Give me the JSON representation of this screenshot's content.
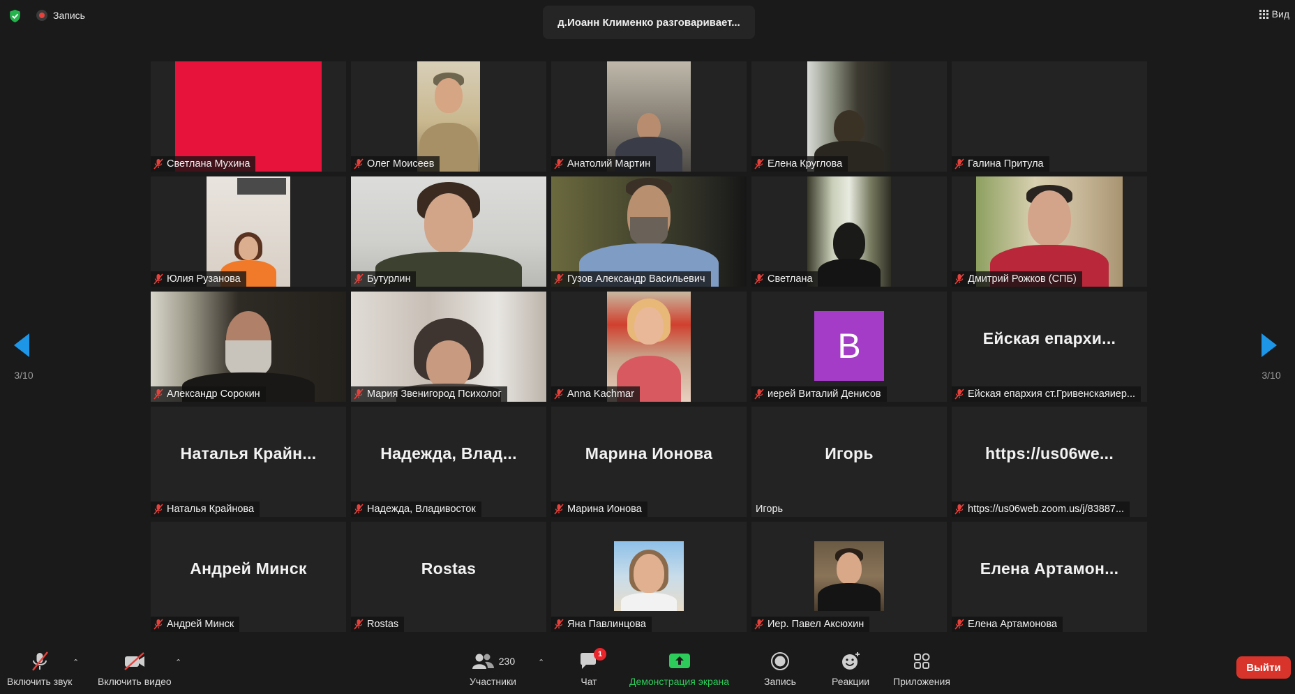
{
  "topbar": {
    "recording": "Запись",
    "speaker": "д.Иоанн Клименко разговаривает...",
    "view": "Вид"
  },
  "pagination": {
    "left": "3/10",
    "right": "3/10"
  },
  "tiles": [
    {
      "label": "Светлана Мухина",
      "big": ""
    },
    {
      "label": "Олег Моисеев",
      "big": ""
    },
    {
      "label": "Анатолий Мартин",
      "big": ""
    },
    {
      "label": "Елена Круглова",
      "big": ""
    },
    {
      "label": "Галина Притула",
      "big": ""
    },
    {
      "label": "Юлия Рузанова",
      "big": ""
    },
    {
      "label": "Бутурлин",
      "big": ""
    },
    {
      "label": "Гузов Александр Васильевич",
      "big": ""
    },
    {
      "label": "Светлана",
      "big": ""
    },
    {
      "label": "Дмитрий Рожков (СПБ)",
      "big": ""
    },
    {
      "label": "Александр Сорокин",
      "big": ""
    },
    {
      "label": "Мария  Звенигород Психолог",
      "big": ""
    },
    {
      "label": "Anna Kachmar",
      "big": ""
    },
    {
      "label": "иерей Виталий Денисов",
      "big": "",
      "avatar": "В"
    },
    {
      "label": "Ейская епархия ст.Гривенскаяиер...",
      "big": "Ейская  епархи..."
    },
    {
      "label": "Наталья Крайнова",
      "big": "Наталья  Крайн..."
    },
    {
      "label": "Надежда, Владивосток",
      "big": "Надежда,  Влад..."
    },
    {
      "label": "Марина Ионова",
      "big": "Марина Ионова"
    },
    {
      "label": "Игорь",
      "big": "Игорь"
    },
    {
      "label": "https://us06web.zoom.us/j/83887...",
      "big": "https://us06we..."
    },
    {
      "label": "Андрей Минск",
      "big": "Андрей Минск"
    },
    {
      "label": "Rostas",
      "big": "Rostas"
    },
    {
      "label": "Яна Павлинцова",
      "big": ""
    },
    {
      "label": "Иер. Павел Аксюхин",
      "big": ""
    },
    {
      "label": "Елена Артамонова",
      "big": "Елена  Артамон..."
    }
  ],
  "toolbar": {
    "unmute": "Включить звук",
    "start_video": "Включить видео",
    "participants": "Участники",
    "participants_count": "230",
    "chat": "Чат",
    "chat_badge": "1",
    "share": "Демонстрация экрана",
    "record": "Запись",
    "reactions": "Реакции",
    "apps": "Приложения",
    "leave": "Выйти"
  },
  "colors": {
    "background": "#1a1a1a",
    "tile": "#232323",
    "accent_blue": "#1e96e8",
    "share_green": "#2dcb5a",
    "leave_red": "#d9342b",
    "avatar_purple": "#a53cc8"
  }
}
